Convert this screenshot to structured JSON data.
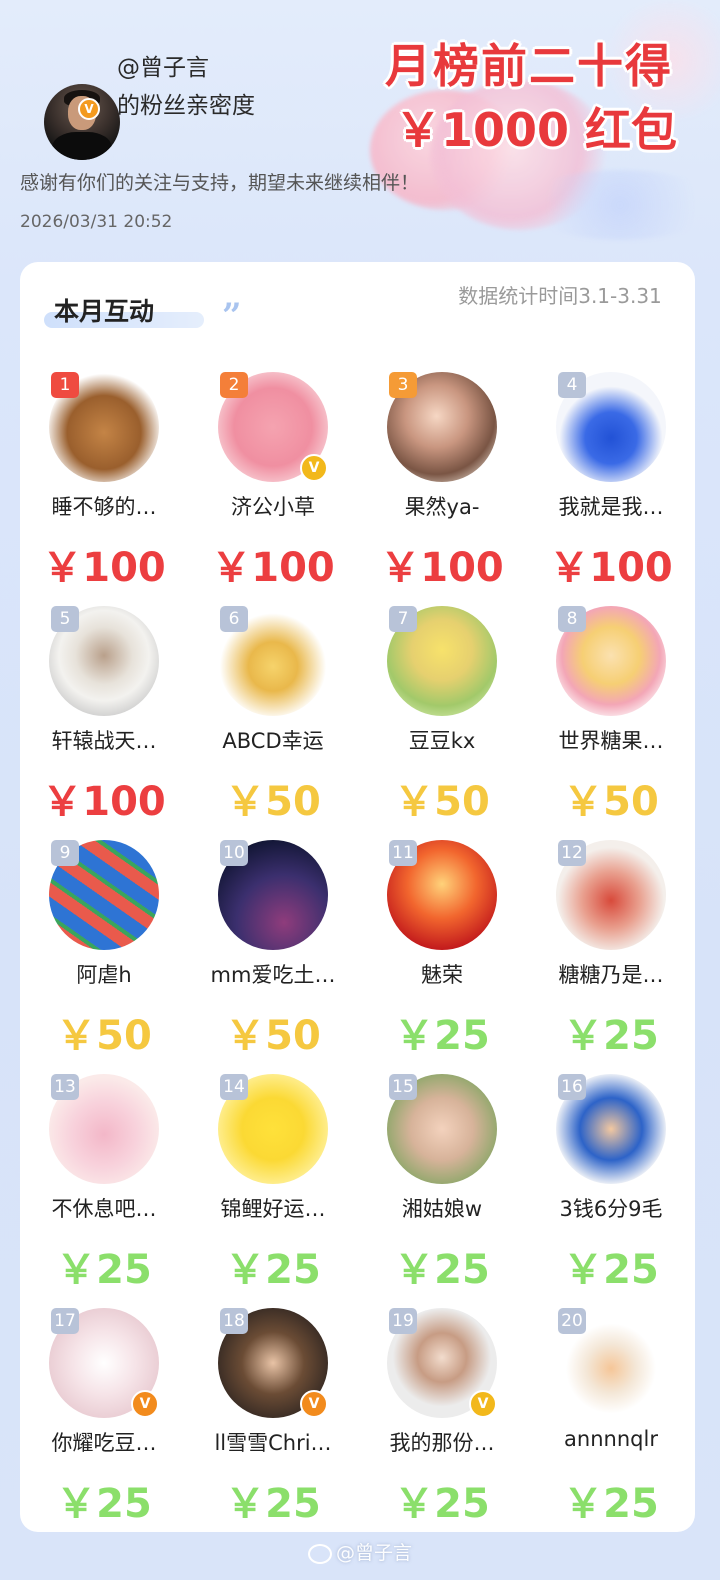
{
  "header": {
    "handle": "@曾子言",
    "subtitle": "的粉丝亲密度",
    "promo_line1": "月榜前二十得",
    "promo_line2": "￥1000 红包",
    "thanks": "感谢有你们的关注与支持，期望未来继续相伴！",
    "timestamp": "2026/03/31  20:52",
    "verify_icon": "v-badge-icon"
  },
  "card": {
    "section_title": "本月互动",
    "quote_mark": "”",
    "stats_time": "数据统计时间3.1-3.31"
  },
  "fans": [
    {
      "rank": "1",
      "name": "睡不够的…",
      "amount": "￥100",
      "tier": "red",
      "avatar": "dog-avatar",
      "verified": ""
    },
    {
      "rank": "2",
      "name": "济公小草",
      "amount": "￥100",
      "tier": "red",
      "avatar": "pink-creature-avatar",
      "verified": "gold"
    },
    {
      "rank": "3",
      "name": "果然ya-",
      "amount": "￥100",
      "tier": "red",
      "avatar": "girl-with-dog-avatar",
      "verified": ""
    },
    {
      "rank": "4",
      "name": "我就是我…",
      "amount": "￥100",
      "tier": "red",
      "avatar": "blue-dress-girl-avatar",
      "verified": ""
    },
    {
      "rank": "5",
      "name": "轩辕战天…",
      "amount": "￥100",
      "tier": "red",
      "avatar": "cup-avatar",
      "verified": ""
    },
    {
      "rank": "6",
      "name": "ABCD幸运",
      "amount": "￥50",
      "tier": "yellow",
      "avatar": "queen-cartoon-avatar",
      "verified": ""
    },
    {
      "rank": "7",
      "name": "豆豆kx",
      "amount": "￥50",
      "tier": "yellow",
      "avatar": "sunflower-girl-avatar",
      "verified": ""
    },
    {
      "rank": "8",
      "name": "世界糖果…",
      "amount": "￥50",
      "tier": "yellow",
      "avatar": "sailor-moon-avatar",
      "verified": ""
    },
    {
      "rank": "9",
      "name": "阿虐h",
      "amount": "￥50",
      "tier": "yellow",
      "avatar": "watermelon-avatar",
      "verified": ""
    },
    {
      "rank": "10",
      "name": "mm爱吃土…",
      "amount": "￥50",
      "tier": "yellow",
      "avatar": "night-sky-avatar",
      "verified": ""
    },
    {
      "rank": "11",
      "name": "魅荣",
      "amount": "￥25",
      "tier": "green",
      "avatar": "fire-warrior-avatar",
      "verified": ""
    },
    {
      "rank": "12",
      "name": "糖糖乃是…",
      "amount": "￥25",
      "tier": "green",
      "avatar": "hanfu-girl-avatar",
      "verified": ""
    },
    {
      "rank": "13",
      "name": "不休息吧…",
      "amount": "￥25",
      "tier": "green",
      "avatar": "pink-dress-girl-avatar",
      "verified": ""
    },
    {
      "rank": "14",
      "name": "锦鲤好运…",
      "amount": "￥25",
      "tier": "green",
      "avatar": "pikachu-avatar",
      "verified": ""
    },
    {
      "rank": "15",
      "name": "湘姑娘w",
      "amount": "￥25",
      "tier": "green",
      "avatar": "baby-girl-avatar",
      "verified": ""
    },
    {
      "rank": "16",
      "name": "3钱6分9毛",
      "amount": "￥25",
      "tier": "green",
      "avatar": "goku-avatar",
      "verified": ""
    },
    {
      "rank": "17",
      "name": "你耀吃豆…",
      "amount": "￥25",
      "tier": "green",
      "avatar": "plush-toy-avatar",
      "verified": "orange"
    },
    {
      "rank": "18",
      "name": "ll雪雪Chri…",
      "amount": "￥25",
      "tier": "green",
      "avatar": "bear-hat-girl-avatar",
      "verified": "orange"
    },
    {
      "rank": "19",
      "name": "我的那份…",
      "amount": "￥25",
      "tier": "green",
      "avatar": "woman-portrait-avatar",
      "verified": "gold"
    },
    {
      "rank": "20",
      "name": "annnnqlr",
      "amount": "￥25",
      "tier": "green",
      "avatar": "straw-hat-kid-avatar",
      "verified": ""
    }
  ],
  "watermark": "@曾子言",
  "colors": {
    "red_amount": "#ec3e40",
    "yellow_amount": "#f5c840",
    "green_amount": "#8bdf6b",
    "promo_red": "#e8393c"
  }
}
